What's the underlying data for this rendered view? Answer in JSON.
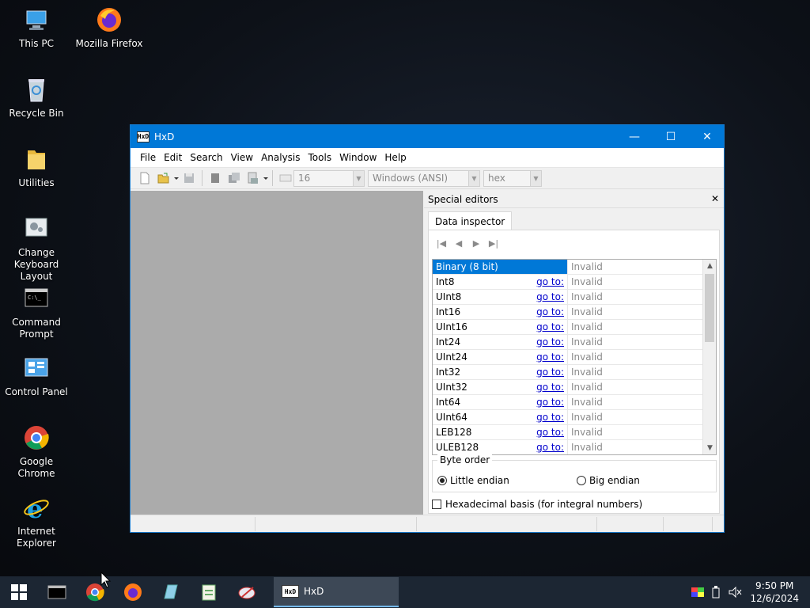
{
  "desktop": {
    "icons": [
      {
        "label": "This PC"
      },
      {
        "label": "Mozilla Firefox"
      },
      {
        "label": "Recycle Bin"
      },
      {
        "label": "Utilities"
      },
      {
        "label": "Change Keyboard Layout"
      },
      {
        "label": "Command Prompt"
      },
      {
        "label": "Control Panel"
      },
      {
        "label": "Google Chrome"
      },
      {
        "label": "Internet Explorer"
      }
    ]
  },
  "window": {
    "title": "HxD",
    "icon_text": "HxD",
    "controls": {
      "minimize": "—",
      "maximize": "☐",
      "close": "✕"
    },
    "menu": [
      "File",
      "Edit",
      "Search",
      "View",
      "Analysis",
      "Tools",
      "Window",
      "Help"
    ],
    "toolbar": {
      "bytes_per_row": "16",
      "charset": "Windows (ANSI)",
      "offset_base": "hex"
    },
    "special_editors": {
      "title": "Special editors",
      "close": "✕",
      "tab": "Data inspector",
      "nav": [
        "|◀",
        "◀",
        "▶",
        "▶|"
      ],
      "goto_label": "go to:",
      "rows": [
        {
          "name": "Binary (8 bit)",
          "value": "Invalid",
          "goto": false,
          "selected": true
        },
        {
          "name": "Int8",
          "value": "Invalid",
          "goto": true
        },
        {
          "name": "UInt8",
          "value": "Invalid",
          "goto": true
        },
        {
          "name": "Int16",
          "value": "Invalid",
          "goto": true
        },
        {
          "name": "UInt16",
          "value": "Invalid",
          "goto": true
        },
        {
          "name": "Int24",
          "value": "Invalid",
          "goto": true
        },
        {
          "name": "UInt24",
          "value": "Invalid",
          "goto": true
        },
        {
          "name": "Int32",
          "value": "Invalid",
          "goto": true
        },
        {
          "name": "UInt32",
          "value": "Invalid",
          "goto": true
        },
        {
          "name": "Int64",
          "value": "Invalid",
          "goto": true
        },
        {
          "name": "UInt64",
          "value": "Invalid",
          "goto": true
        },
        {
          "name": "LEB128",
          "value": "Invalid",
          "goto": true
        },
        {
          "name": "ULEB128",
          "value": "Invalid",
          "goto": true
        }
      ],
      "byte_order": {
        "legend": "Byte order",
        "little": "Little endian",
        "big": "Big endian",
        "selected": "little"
      },
      "hex_basis": "Hexadecimal basis (for integral numbers)"
    }
  },
  "taskbar": {
    "active_task": "HxD",
    "time": "9:50 PM",
    "date": "12/6/2024"
  },
  "colors": {
    "titlebar": "#0078d7",
    "selection": "#0078d7",
    "taskbar": "#1c2633"
  }
}
